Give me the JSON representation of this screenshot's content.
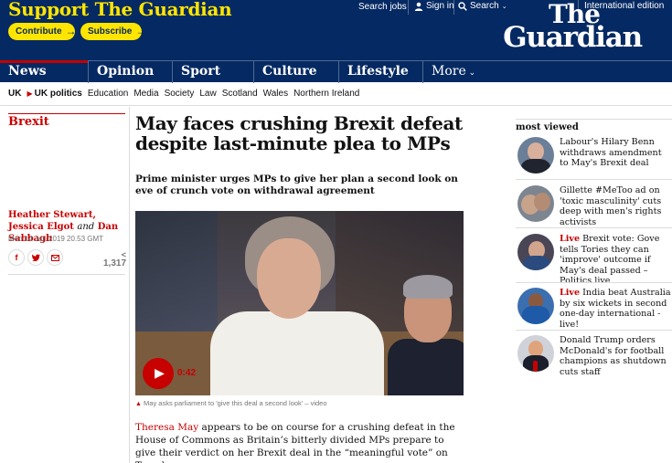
{
  "header": {
    "support_title": "Support The Guardian",
    "contribute_label": "Contribute",
    "subscribe_label": "Subscribe",
    "arrow": "→",
    "search_jobs": "Search jobs",
    "sign_in": "Sign in",
    "search": "Search",
    "edition": "International edition",
    "logo_the": "The",
    "logo_guardian": "Guardian",
    "brand_yellow": "#ffe500",
    "brand_blue": "#052962"
  },
  "pillars": [
    {
      "label": "News"
    },
    {
      "label": "Opinion"
    },
    {
      "label": "Sport"
    },
    {
      "label": "Culture"
    },
    {
      "label": "Lifestyle"
    },
    {
      "label": "More"
    }
  ],
  "subnav": {
    "items": [
      "UK",
      "UK politics",
      "Education",
      "Media",
      "Society",
      "Law",
      "Scotland",
      "Wales",
      "Northern Ireland"
    ]
  },
  "article": {
    "section": "Brexit",
    "byline_1": "Heather Stewart, Jessica Elgot",
    "byline_and": "and",
    "byline_2": "Dan Sabbagh",
    "date": "Mon 14 Jan 2019 20.53 GMT",
    "share_count": "1,317",
    "headline": "May faces crushing Brexit defeat despite last-minute plea to MPs",
    "standfirst": "Prime minister urges MPs to give her plan a second look on eve of crunch vote on withdrawal agreement",
    "video_duration": "0:42",
    "caption": "May asks parliament to 'give this deal a second look' – video",
    "body_link": "Theresa May",
    "body_text": " appears to be on course for a crushing defeat in the House of Commons as Britain’s bitterly divided MPs prepare to give their verdict on her Brexit deal in the “meaningful vote” on Tuesday."
  },
  "most_viewed": {
    "title": "most viewed",
    "items": [
      {
        "live": "",
        "text": "Labour's Hilary Benn withdraws amendment to May's Brexit deal"
      },
      {
        "live": "",
        "text": "Gillette #MeToo ad on 'toxic masculinity' cuts deep with men's rights activists"
      },
      {
        "live": "Live",
        "text": " Brexit vote: Gove tells Tories they can 'improve' outcome if May's deal passed – Politics live"
      },
      {
        "live": "Live",
        "text": " India beat Australia by six wickets in second one-day international - live!"
      },
      {
        "live": "",
        "text": "Donald Trump orders McDonald's for football champions as shutdown cuts staff"
      }
    ]
  }
}
